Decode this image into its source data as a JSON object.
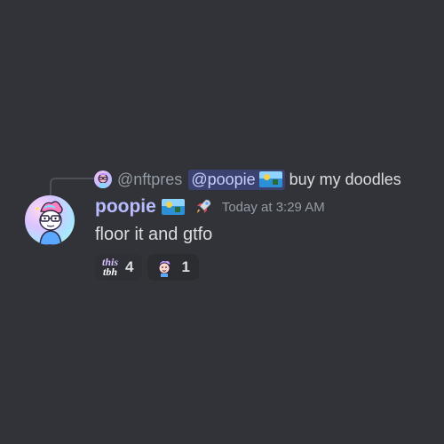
{
  "colors": {
    "background": "#313338",
    "username": "#b9bcff",
    "mention_bg": "#3c4270",
    "mention_text": "#c9cdfb",
    "muted": "#949ba4",
    "text": "#dbdee1"
  },
  "reply": {
    "author": "@nftpres",
    "mention": "@poopie",
    "mention_icon": "landscape-flag-icon",
    "content": "buy my doodles"
  },
  "message": {
    "username": "poopie",
    "username_badge": "landscape-flag-icon",
    "role_icon": "rocket-icon",
    "timestamp": "Today at 3:29 AM",
    "content": "floor it and gtfo"
  },
  "reactions": [
    {
      "emoji_text_top": "this",
      "emoji_text_bottom": "tbh",
      "emoji": "this-tbh-emoji",
      "count": "4"
    },
    {
      "emoji": "doodle-face-emoji",
      "count": "1"
    }
  ]
}
